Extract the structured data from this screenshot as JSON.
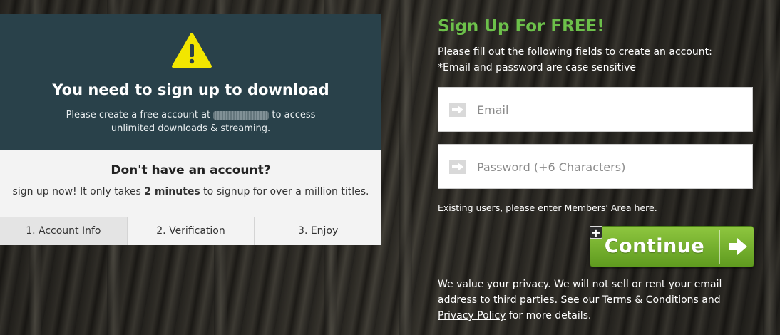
{
  "warning": {
    "icon": "warning-icon",
    "title": "You need to sign up to download",
    "text_before": "Please create a free account at",
    "text_after": "to access unlimited downloads & streaming."
  },
  "account": {
    "title": "Don't have an account?",
    "text_before": "sign up now! It only takes ",
    "text_bold": "2 minutes",
    "text_after": " to signup for over a million titles."
  },
  "steps": [
    {
      "label": "1. Account Info"
    },
    {
      "label": "2. Verification"
    },
    {
      "label": "3. Enjoy"
    }
  ],
  "signup": {
    "title": "Sign Up For FREE!",
    "line1": "Please fill out the following fields to create an account:",
    "line2": "*Email and password are case sensitive",
    "email_placeholder": "Email",
    "password_placeholder": "Password (+6 Characters)",
    "existing_link": "Existing users, please enter Members' Area here.",
    "continue_label": "Continue",
    "plus": "+"
  },
  "privacy": {
    "text1": "We value your privacy. We will not sell or rent your email address to third parties. See our ",
    "terms_link": "Terms & Conditions",
    "and": " and ",
    "privacy_link": "Privacy Policy",
    "text2": " for more details."
  },
  "colors": {
    "accent_green": "#6cc04a",
    "panel_teal": "#29414a",
    "button_green": "#8ec63f"
  }
}
